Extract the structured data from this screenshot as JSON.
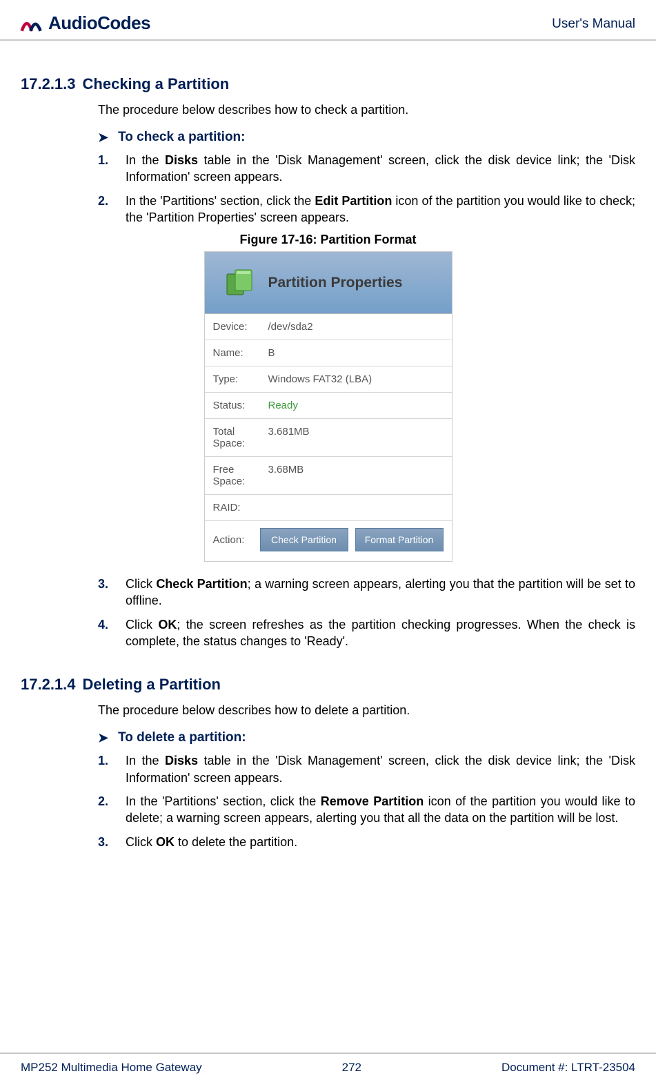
{
  "header": {
    "brand": "AudioCodes",
    "right": "User's Manual"
  },
  "section1": {
    "number": "17.2.1.3",
    "title": "Checking a Partition",
    "intro": "The procedure below describes how to check a partition.",
    "procHeading": "To check a partition:",
    "steps": [
      {
        "num": "1.",
        "pre": "In the ",
        "b1": "Disks",
        "post": " table in the 'Disk Management' screen, click the disk device link; the 'Disk Information' screen appears."
      },
      {
        "num": "2.",
        "pre": "In the 'Partitions' section, click the ",
        "b1": "Edit Partition",
        "post": " icon of the partition you would like to check; the 'Partition Properties' screen appears."
      }
    ],
    "steps2": [
      {
        "num": "3.",
        "pre": "Click ",
        "b1": "Check Partition",
        "post": "; a warning screen appears, alerting you that the partition will be set to offline."
      },
      {
        "num": "4.",
        "pre": "Click ",
        "b1": "OK",
        "post": "; the screen refreshes as the partition checking progresses. When the check is complete, the status changes to 'Ready'."
      }
    ]
  },
  "figure": {
    "caption": "Figure 17-16: Partition Format",
    "panelTitle": "Partition Properties",
    "rows": {
      "deviceLabel": "Device:",
      "deviceValue": "/dev/sda2",
      "nameLabel": "Name:",
      "nameValue": "B",
      "typeLabel": "Type:",
      "typeValue": "Windows FAT32 (LBA)",
      "statusLabel": "Status:",
      "statusValue": "Ready",
      "totalLabel": "Total Space:",
      "totalValue": "3.681MB",
      "freeLabel": "Free Space:",
      "freeValue": "3.68MB",
      "raidLabel": "RAID:",
      "raidValue": "",
      "actionLabel": "Action:",
      "btnCheck": "Check Partition",
      "btnFormat": "Format Partition"
    }
  },
  "section2": {
    "number": "17.2.1.4",
    "title": "Deleting a Partition",
    "intro": "The procedure below describes how to delete a partition.",
    "procHeading": "To delete a partition:",
    "steps": [
      {
        "num": "1.",
        "pre": "In the ",
        "b1": "Disks",
        "post": " table in the 'Disk Management' screen, click the disk device link; the 'Disk Information' screen appears."
      },
      {
        "num": "2.",
        "pre": "In the 'Partitions' section, click the ",
        "b1": "Remove Partition",
        "post": " icon of the partition you would like to delete; a warning screen appears, alerting you that all the data on the partition will be lost."
      },
      {
        "num": "3.",
        "pre": "Click ",
        "b1": "OK",
        "post": " to delete the partition."
      }
    ]
  },
  "footer": {
    "left": "MP252 Multimedia Home Gateway",
    "center": "272",
    "right": "Document #: LTRT-23504"
  }
}
